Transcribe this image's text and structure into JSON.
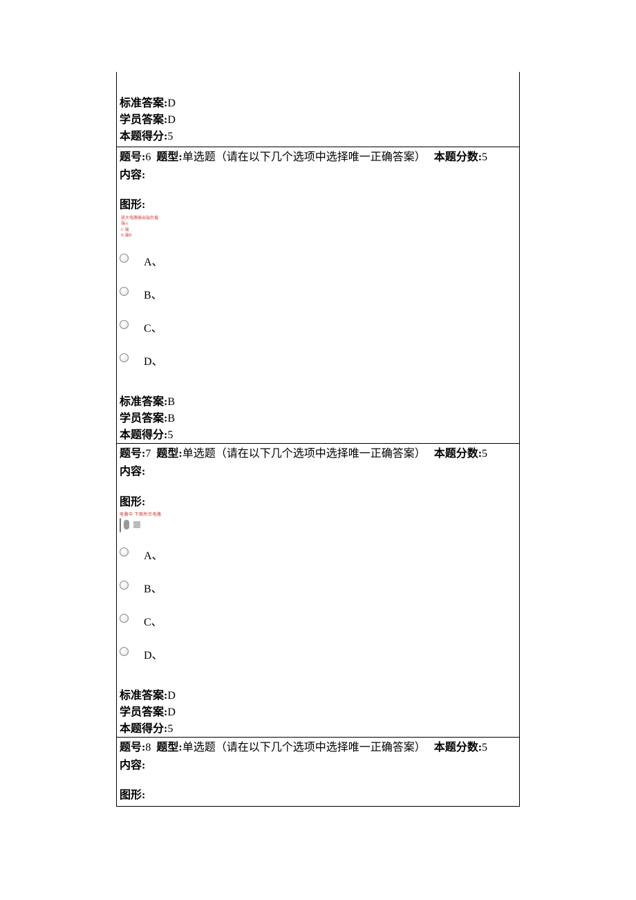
{
  "labels": {
    "std_answer": "标准答案:",
    "stu_answer": "学员答案:",
    "score_got": "本题得分:",
    "q_no": "题号:",
    "q_type_label": "题型:",
    "q_type_value": "单选题（请在以下几个选项中选择唯一正确答案）",
    "q_score_label": "本题分数:",
    "content": "内容:",
    "figure": "图形:"
  },
  "top_answers": {
    "std": "D",
    "stu": "D",
    "score": "5"
  },
  "questions": [
    {
      "no": "6",
      "score": "5",
      "options": [
        "A、",
        "B、",
        "C、",
        "D、"
      ],
      "std": "B",
      "stu": "B",
      "got": "5",
      "figure_text": "放大电路输出端负载\n端A\nC   端\nB   端B"
    },
    {
      "no": "7",
      "score": "5",
      "options": [
        "A、",
        "B、",
        "C、",
        "D、"
      ],
      "std": "D",
      "stu": "D",
      "got": "5",
      "figure_text": "电路中  下图所示电路"
    },
    {
      "no": "8",
      "score": "5"
    }
  ]
}
